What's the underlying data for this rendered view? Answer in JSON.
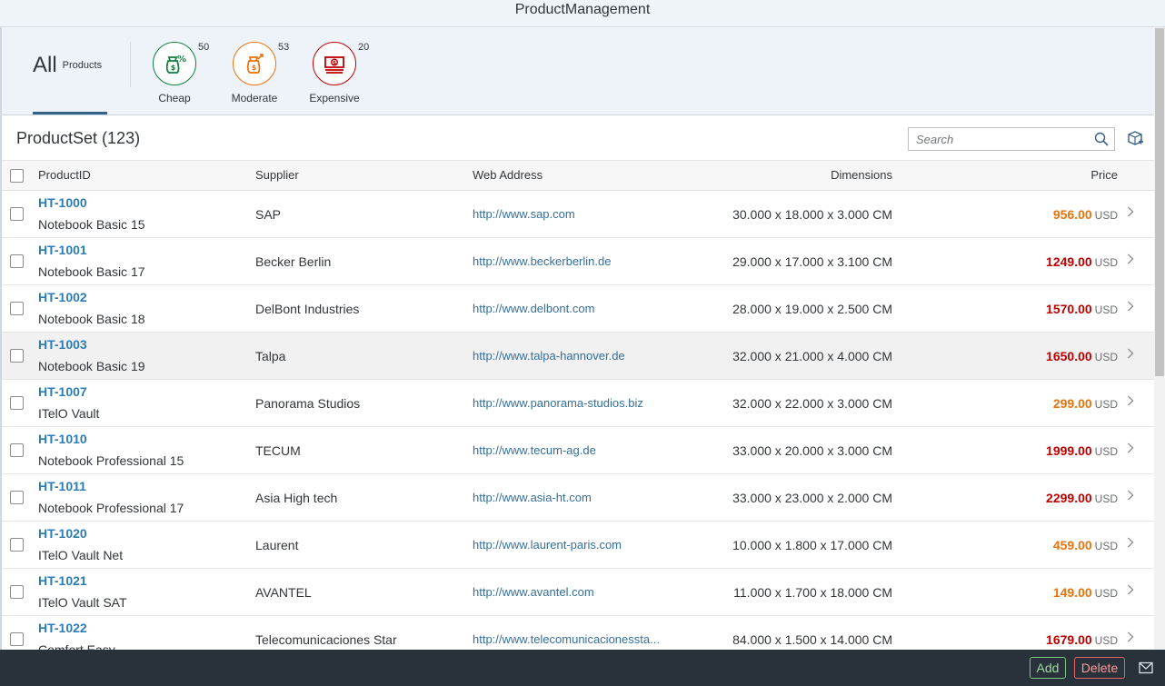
{
  "app_title": "ProductManagement",
  "tabs": {
    "all": {
      "big": "All",
      "small": "Products"
    },
    "cheap": {
      "label": "Cheap",
      "count": "50",
      "color": "#107e3e"
    },
    "moderate": {
      "label": "Moderate",
      "count": "53",
      "color": "#e9730c"
    },
    "expensive": {
      "label": "Expensive",
      "count": "20",
      "color": "#bb0000"
    }
  },
  "table": {
    "title": "ProductSet (123)",
    "search_placeholder": "Search",
    "columns": {
      "product_id": "ProductID",
      "supplier": "Supplier",
      "web": "Web Address",
      "dimensions": "Dimensions",
      "price": "Price"
    },
    "rows": [
      {
        "id": "HT-1000",
        "name": "Notebook Basic 15",
        "supplier": "SAP",
        "web": "http://www.sap.com",
        "dim": "30.000 x 18.000 x 3.000 CM",
        "price": "956.00",
        "cur": "USD",
        "level": "moderate"
      },
      {
        "id": "HT-1001",
        "name": "Notebook Basic 17",
        "supplier": "Becker Berlin",
        "web": "http://www.beckerberlin.de",
        "dim": "29.000 x 17.000 x 3.100 CM",
        "price": "1249.00",
        "cur": "USD",
        "level": "expensive"
      },
      {
        "id": "HT-1002",
        "name": "Notebook Basic 18",
        "supplier": "DelBont Industries",
        "web": "http://www.delbont.com",
        "dim": "28.000 x 19.000 x 2.500 CM",
        "price": "1570.00",
        "cur": "USD",
        "level": "expensive"
      },
      {
        "id": "HT-1003",
        "name": "Notebook Basic 19",
        "supplier": "Talpa",
        "web": "http://www.talpa-hannover.de",
        "dim": "32.000 x 21.000 x 4.000 CM",
        "price": "1650.00",
        "cur": "USD",
        "level": "expensive"
      },
      {
        "id": "HT-1007",
        "name": "ITelO Vault",
        "supplier": "Panorama Studios",
        "web": "http://www.panorama-studios.biz",
        "dim": "32.000 x 22.000 x 3.000 CM",
        "price": "299.00",
        "cur": "USD",
        "level": "moderate"
      },
      {
        "id": "HT-1010",
        "name": "Notebook Professional 15",
        "supplier": "TECUM",
        "web": "http://www.tecum-ag.de",
        "dim": "33.000 x 20.000 x 3.000 CM",
        "price": "1999.00",
        "cur": "USD",
        "level": "expensive"
      },
      {
        "id": "HT-1011",
        "name": "Notebook Professional 17",
        "supplier": "Asia High tech",
        "web": "http://www.asia-ht.com",
        "dim": "33.000 x 23.000 x 2.000 CM",
        "price": "2299.00",
        "cur": "USD",
        "level": "expensive"
      },
      {
        "id": "HT-1020",
        "name": "ITelO Vault Net",
        "supplier": "Laurent",
        "web": "http://www.laurent-paris.com",
        "dim": "10.000 x 1.800 x 17.000 CM",
        "price": "459.00",
        "cur": "USD",
        "level": "moderate"
      },
      {
        "id": "HT-1021",
        "name": "ITelO Vault SAT",
        "supplier": "AVANTEL",
        "web": "http://www.avantel.com",
        "dim": "11.000 x 1.700 x 18.000 CM",
        "price": "149.00",
        "cur": "USD",
        "level": "moderate"
      },
      {
        "id": "HT-1022",
        "name": "Comfort Easy",
        "supplier": "Telecomunicaciones Star",
        "web": "http://www.telecomunicacionessta...",
        "dim": "84.000 x 1.500 x 14.000 CM",
        "price": "1679.00",
        "cur": "USD",
        "level": "expensive"
      }
    ]
  },
  "price_colors": {
    "moderate": "#e9730c",
    "expensive": "#bb0000"
  },
  "footer": {
    "add_label": "Add",
    "delete_label": "Delete"
  }
}
